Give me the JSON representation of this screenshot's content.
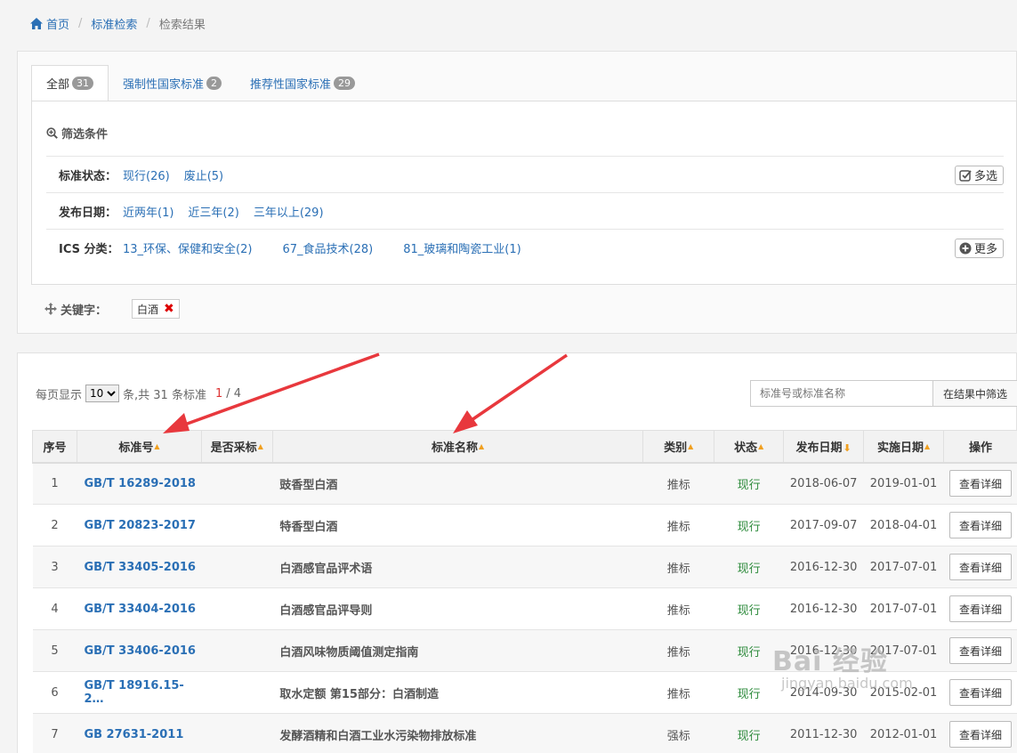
{
  "breadcrumb": {
    "home": "首页",
    "search": "标准检索",
    "current": "检索结果"
  },
  "tabs": [
    {
      "label": "全部",
      "count": "31"
    },
    {
      "label": "强制性国家标准",
      "count": "2"
    },
    {
      "label": "推荐性国家标准",
      "count": "29"
    }
  ],
  "filters": {
    "title": "筛选条件",
    "status": {
      "label": "标准状态：",
      "options": [
        "现行(26)",
        "废止(5)"
      ],
      "button": "多选"
    },
    "date": {
      "label": "发布日期：",
      "options": [
        "近两年(1)",
        "近三年(2)",
        "三年以上(29)"
      ]
    },
    "ics": {
      "label": "ICS 分类：",
      "options": [
        "13_环保、保健和安全(2)",
        "67_食品技术(28)",
        "81_玻璃和陶瓷工业(1)"
      ],
      "button": "更多"
    }
  },
  "keyword": {
    "label": "关键字：",
    "value": "白酒"
  },
  "pager": {
    "prefix": "每页显示",
    "per_page": "10",
    "suffix": "条,共 31 条标准",
    "current_page": "1",
    "total_pages": "/ 4"
  },
  "search": {
    "placeholder": "标准号或标准名称",
    "button": "在结果中筛选"
  },
  "table": {
    "headers": {
      "seq": "序号",
      "code": "标准号",
      "adopted": "是否采标",
      "name": "标准名称",
      "type": "类别",
      "status": "状态",
      "pub_date": "发布日期",
      "impl_date": "实施日期",
      "op": "操作"
    },
    "detail_label": "查看详细",
    "rows": [
      {
        "seq": "1",
        "code": "GB/T 16289-2018",
        "adopted": "",
        "name": "豉香型白酒",
        "type": "推标",
        "status": "现行",
        "pub": "2018-06-07",
        "impl": "2019-01-01"
      },
      {
        "seq": "2",
        "code": "GB/T 20823-2017",
        "adopted": "",
        "name": "特香型白酒",
        "type": "推标",
        "status": "现行",
        "pub": "2017-09-07",
        "impl": "2018-04-01"
      },
      {
        "seq": "3",
        "code": "GB/T 33405-2016",
        "adopted": "",
        "name": "白酒感官品评术语",
        "type": "推标",
        "status": "现行",
        "pub": "2016-12-30",
        "impl": "2017-07-01"
      },
      {
        "seq": "4",
        "code": "GB/T 33404-2016",
        "adopted": "",
        "name": "白酒感官品评导则",
        "type": "推标",
        "status": "现行",
        "pub": "2016-12-30",
        "impl": "2017-07-01"
      },
      {
        "seq": "5",
        "code": "GB/T 33406-2016",
        "adopted": "",
        "name": "白酒风味物质阈值测定指南",
        "type": "推标",
        "status": "现行",
        "pub": "2016-12-30",
        "impl": "2017-07-01"
      },
      {
        "seq": "6",
        "code": "GB/T 18916.15-2…",
        "adopted": "",
        "name": "取水定额 第15部分：白酒制造",
        "type": "推标",
        "status": "现行",
        "pub": "2014-09-30",
        "impl": "2015-02-01"
      },
      {
        "seq": "7",
        "code": "GB 27631-2011",
        "adopted": "",
        "name": "发酵酒精和白酒工业水污染物排放标准",
        "type": "强标",
        "status": "现行",
        "pub": "2011-12-30",
        "impl": "2012-01-01"
      }
    ]
  },
  "watermark": {
    "main": "Bai 经验",
    "sub": "jingyan.baidu.com"
  },
  "colors": {
    "link": "#2a6fb5",
    "status_active": "#2e8b3c",
    "arrow": "#e8383d",
    "sort": "#f0a020"
  }
}
